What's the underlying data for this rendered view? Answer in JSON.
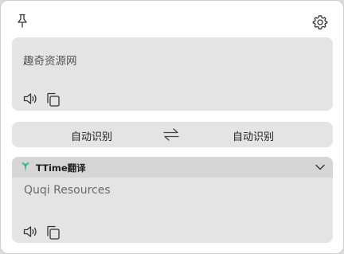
{
  "source": {
    "text": "趣奇资源网"
  },
  "languages": {
    "from": "自动识别",
    "to": "自动识别"
  },
  "result": {
    "service_name": "TTime翻译",
    "text": "Quqi Resources"
  },
  "icons": {
    "pin": "pin-icon",
    "settings": "gear-icon",
    "speak": "speaker-icon",
    "copy": "copy-icon",
    "swap": "swap-icon",
    "collapse": "chevron-down-icon",
    "service": "ttime-logo"
  },
  "colors": {
    "panel": "#e4e4e4",
    "header": "#d6d6d6",
    "logo": "#1fb07a"
  }
}
